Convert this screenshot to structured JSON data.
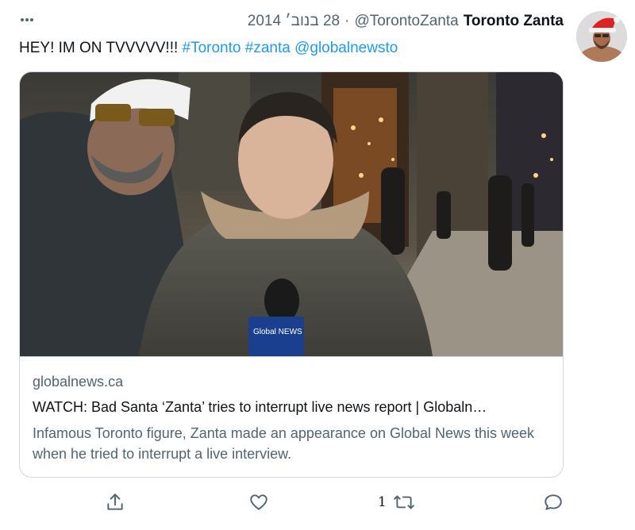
{
  "header": {
    "display_name": "Toronto Zanta",
    "handle": "@TorontoZanta",
    "separator": "·",
    "date": "28 בנוב׳ 2014"
  },
  "tweet": {
    "text_prefix": "HEY! IM ON TVVVVV!!! ",
    "hashtags": [
      "#Toronto",
      "#zanta"
    ],
    "mention": "@globalnewsto"
  },
  "card": {
    "domain": "globalnews.ca",
    "title": "WATCH: Bad Santa ‘Zanta’ tries to interrupt live news report | Globaln…",
    "description": "Infamous Toronto figure, Zanta made an appearance on Global News this week when he tried to interrupt a live interview.",
    "mic_flag_text": "Global NEWS"
  },
  "actions": {
    "share_icon": "share-icon",
    "like_icon": "heart-icon",
    "retweet_icon": "retweet-icon",
    "retweet_count": "1",
    "reply_icon": "reply-icon"
  },
  "colors": {
    "link": "#1d9bf0",
    "secondary_text": "#536471",
    "primary_text": "#0f1419",
    "border": "#cfd9de"
  }
}
